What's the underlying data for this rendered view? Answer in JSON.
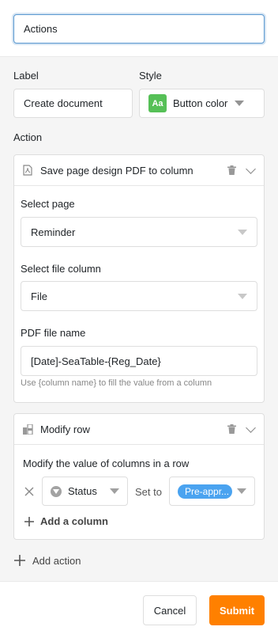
{
  "header": {
    "title_value": "Actions"
  },
  "label_field": {
    "label": "Label",
    "value": "Create document"
  },
  "style_field": {
    "label": "Style",
    "badge": "Aa",
    "value": "Button color"
  },
  "action_section": {
    "label": "Action"
  },
  "pdf_action": {
    "title": "Save page design PDF to column",
    "select_page_label": "Select page",
    "select_page_value": "Reminder",
    "file_column_label": "Select file column",
    "file_column_value": "File",
    "pdf_name_label": "PDF file name",
    "pdf_name_value": "[Date]-SeaTable-{Reg_Date}",
    "hint": "Use {column name} to fill the value from a column"
  },
  "modify_action": {
    "title": "Modify row",
    "description": "Modify the value of columns in a row",
    "column_value": "Status",
    "set_to_label": "Set to",
    "set_value": "Pre-appr...",
    "add_column_label": "Add a column"
  },
  "add_action_label": "Add action",
  "footer": {
    "cancel_label": "Cancel",
    "submit_label": "Submit"
  },
  "colors": {
    "accent": "#ff8000",
    "focus": "#5a98d0",
    "style_badge": "#56c057",
    "option_pill": "#4aa3f0"
  },
  "icons": [
    "pdf-icon",
    "trash-icon",
    "chevron-down-icon",
    "modify-row-icon",
    "close-icon",
    "status-column-icon",
    "plus-icon"
  ]
}
